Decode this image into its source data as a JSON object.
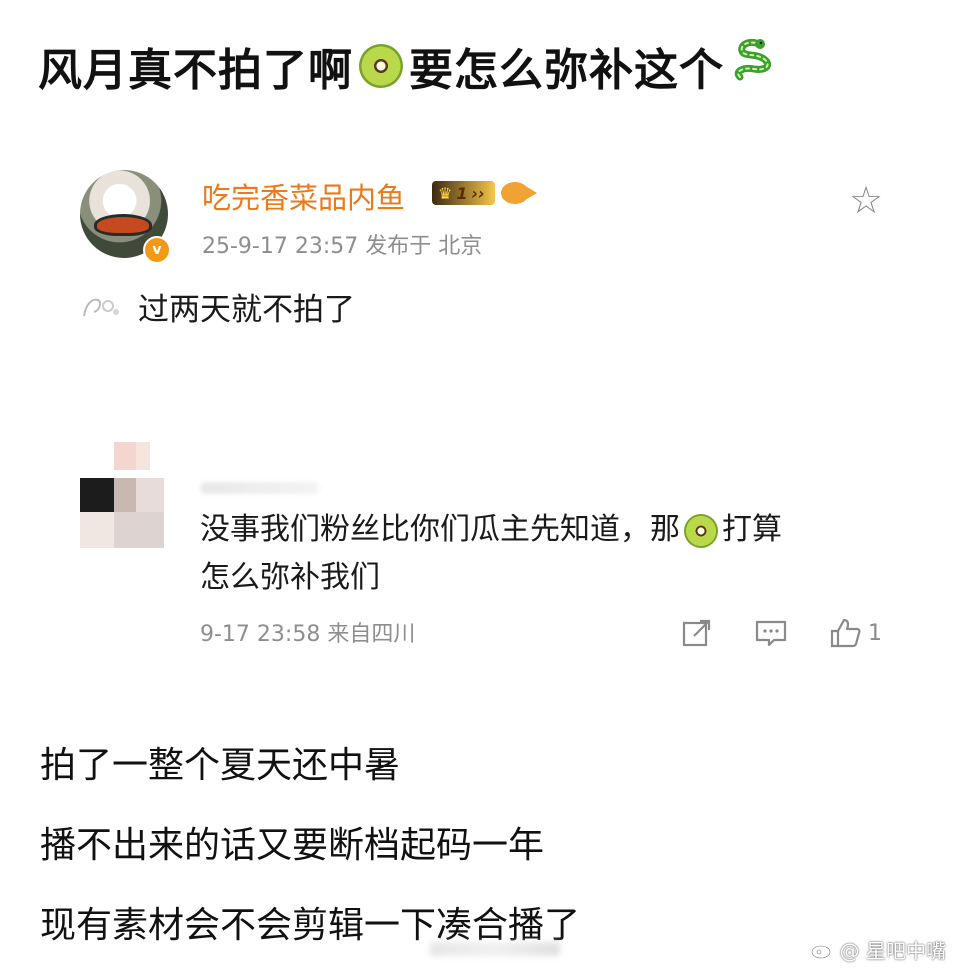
{
  "headline": {
    "before": "风月真不拍了啊",
    "middle": "要怎么弥补这个",
    "kiwi_icon": "kiwi-fruit-emoji",
    "snake_icon": "snake-emoji"
  },
  "post": {
    "username": "吃完香菜品内鱼",
    "vip_level": "1",
    "timestamp": "25-9-17 23:57",
    "location": "发布于 北京",
    "text": "过两天就不拍了",
    "colors": {
      "username": "#ea7a1a",
      "verified": "#f29a16"
    }
  },
  "comment": {
    "text_line1": "没事我们粉丝比你们瓜主先知道，那",
    "text_line1_end": "打算",
    "text_line2": "怎么弥补我们",
    "timestamp": "9-17 23:58",
    "location": "来自四川",
    "like_count": "1"
  },
  "body": {
    "lines": [
      "拍了一整个夏天还中暑",
      "播不出来的话又要断档起码一年",
      "现有素材会不会剪辑一下凑合播了"
    ]
  },
  "watermark": {
    "text": "@ 星吧中嘴"
  }
}
